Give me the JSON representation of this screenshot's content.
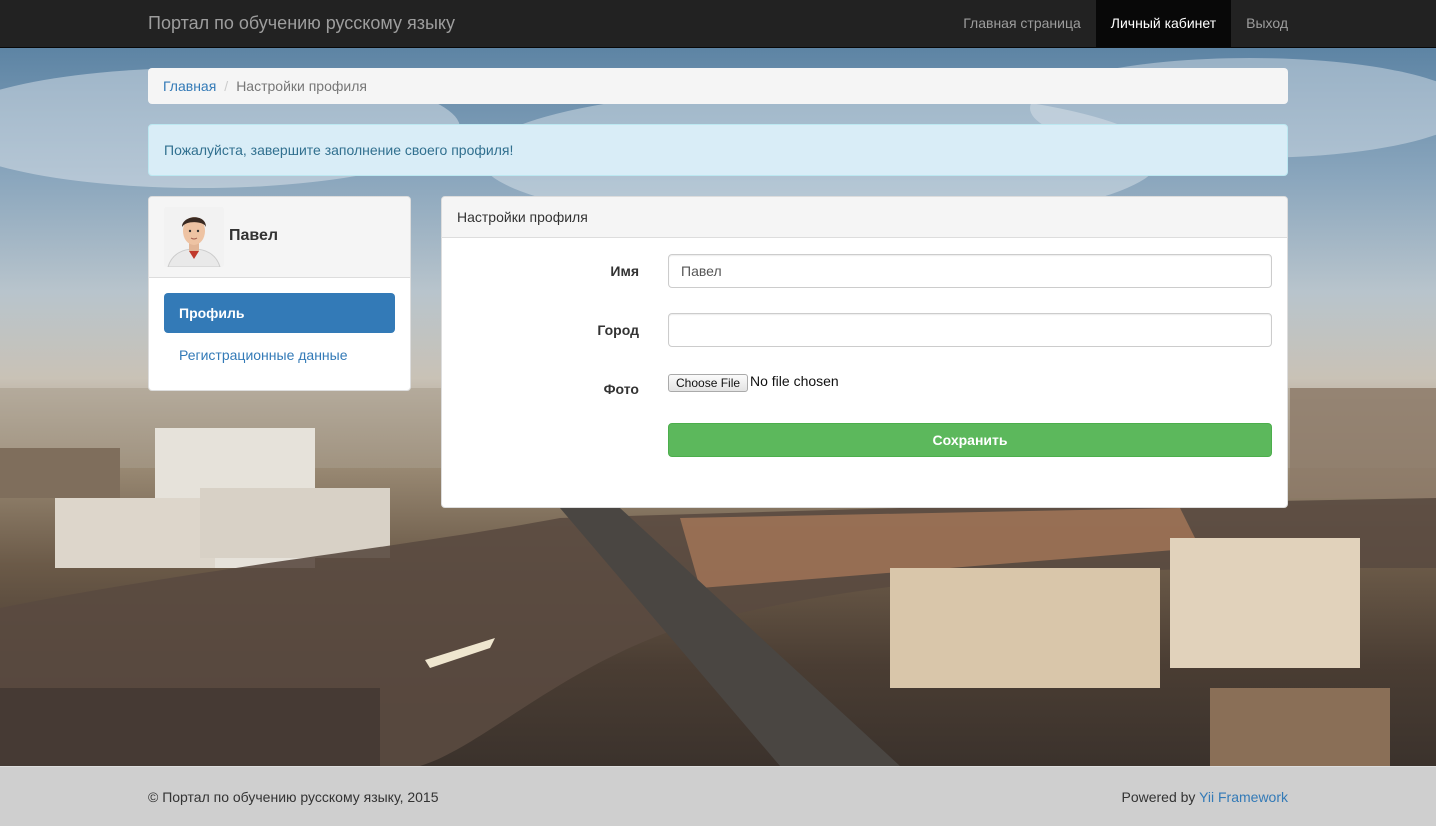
{
  "navbar": {
    "brand": "Портал по обучению русскому языку",
    "items": [
      {
        "label": "Главная страница"
      },
      {
        "label": "Личный кабинет"
      },
      {
        "label": "Выход"
      }
    ]
  },
  "breadcrumb": {
    "home": "Главная",
    "current": "Настройки профиля"
  },
  "alert": {
    "text": "Пожалуйста, завершите заполнение своего профиля!"
  },
  "sidebar": {
    "user_name": "Павел",
    "items": [
      {
        "label": "Профиль"
      },
      {
        "label": "Регистрационные данные"
      }
    ]
  },
  "form": {
    "title": "Настройки профиля",
    "name_label": "Имя",
    "name_value": "Павел",
    "city_label": "Город",
    "city_value": "",
    "photo_label": "Фото",
    "file_button": "Choose File",
    "file_status": "No file chosen",
    "save_label": "Сохранить"
  },
  "footer": {
    "copyright": "© Портал по обучению русскому языку, 2015",
    "powered_prefix": "Powered by",
    "powered_link": "Yii Framework"
  }
}
